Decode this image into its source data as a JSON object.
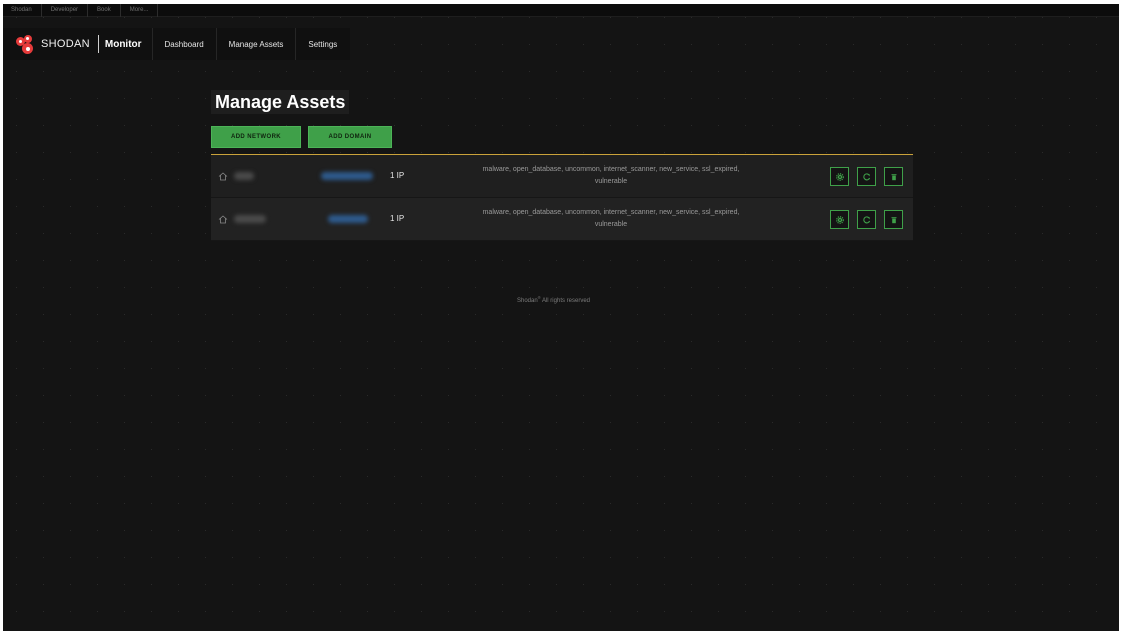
{
  "topbar": {
    "links": [
      "Shodan",
      "Developer",
      "Book",
      "More..."
    ]
  },
  "navbar": {
    "brand_name": "SHODAN",
    "product": "Monitor",
    "items": [
      "Dashboard",
      "Manage Assets",
      "Settings"
    ]
  },
  "main": {
    "title": "Manage Assets",
    "add_network_label": "ADD NETWORK",
    "add_domain_label": "ADD DOMAIN",
    "assets": [
      {
        "ip_count": "1 IP",
        "tags_line1": "malware, open_database, uncommon, internet_scanner, new_service, ssl_expired,",
        "tags_line2": "vulnerable"
      },
      {
        "ip_count": "1 IP",
        "tags_line1": "malware, open_database, uncommon, internet_scanner, new_service, ssl_expired,",
        "tags_line2": "vulnerable"
      }
    ]
  },
  "footer": {
    "brand": "Shodan",
    "mark": "®",
    "text": " All rights reserved"
  },
  "colors": {
    "accent_green": "#3fa049",
    "divider_gold": "#caa23a",
    "brand_red": "#e63b3b",
    "background": "#141414"
  },
  "icons": [
    "home-icon",
    "gear-icon",
    "refresh-icon",
    "trash-icon"
  ]
}
